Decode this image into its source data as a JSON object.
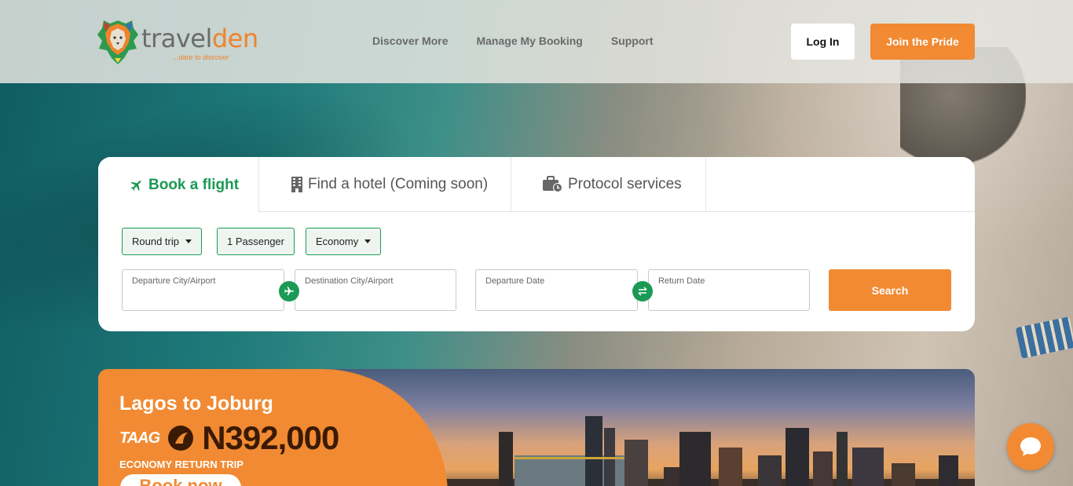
{
  "brand": {
    "name_part1": "travel",
    "name_part2": "den",
    "tagline": "...dare to discover"
  },
  "nav": {
    "items": [
      "Discover More",
      "Manage My Booking",
      "Support"
    ],
    "login_label": "Log In",
    "join_label": "Join the Pride"
  },
  "booking": {
    "tabs": [
      {
        "label": "Book a flight",
        "icon": "plane-icon",
        "active": true
      },
      {
        "label": "Find a hotel (Coming soon)",
        "icon": "building-icon",
        "active": false
      },
      {
        "label": "Protocol services",
        "icon": "briefcase-clock-icon",
        "active": false
      }
    ],
    "trip_type": "Round trip",
    "passengers": "1 Passenger",
    "cabin": "Economy",
    "departure_city_label": "Departure City/Airport",
    "destination_city_label": "Destination City/Airport",
    "departure_date_label": "Departure Date",
    "return_date_label": "Return Date",
    "search_label": "Search"
  },
  "promo": {
    "title_part1": "Lagos to ",
    "title_part2": "Joburg",
    "airline": "TAAG",
    "price": "N392,000",
    "subtitle": "ECONOMY RETURN TRIP",
    "cta": "Book now"
  },
  "colors": {
    "accent_orange": "#f18a32",
    "accent_green": "#1a9a55"
  },
  "chat": {
    "icon": "chat-bubble-icon"
  }
}
